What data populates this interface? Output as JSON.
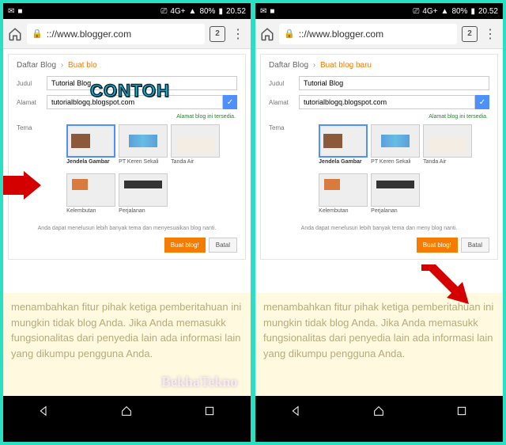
{
  "status": {
    "net": "4G+",
    "battery": "80%",
    "time": "20.52"
  },
  "chrome": {
    "url": ":://www.blogger.com",
    "tabs": "2"
  },
  "dialog": {
    "crumb_root": "Daftar Blog",
    "crumb_sep": "›",
    "crumb_cur_left": "Buat blo",
    "crumb_cur_full": "Buat blog baru",
    "lbl_title": "Judul",
    "val_title": "Tutorial Blog",
    "lbl_addr": "Alamat",
    "val_addr": "tutorialblogq.blogspot.com",
    "avail": "Alamat blog ini tersedia.",
    "lbl_theme": "Tema",
    "themes": [
      {
        "name": "Jendela Gambar",
        "cls": "th-jg",
        "selected": true
      },
      {
        "name": "PT Keren Sekali",
        "cls": "th-pt",
        "selected": false
      },
      {
        "name": "Tanda Air",
        "cls": "th-ta",
        "selected": false
      },
      {
        "name": "Kelembutan",
        "cls": "th-kl",
        "selected": false
      },
      {
        "name": "Perjalanan",
        "cls": "th-pj",
        "selected": false
      }
    ],
    "note_left": "Anda dapat menelusuri lebih banyak tema dan menyesuaikan blog nanti.",
    "note_right": "Anda dapat menelusuri lebih banyak tema dan meny         blog nanti.",
    "btn_create": "Buat blog!",
    "btn_cancel": "Batal"
  },
  "bg_text": "menambahkan fitur pihak ketiga pemberitahuan ini mungkin tidak blog Anda. Jika Anda memasukk fungsionalitas dari penyedia lain ada informasi lain yang dikumpu pengguna Anda.",
  "anno": {
    "contoh": "CONTOH",
    "watermark": "BekhaTekno"
  }
}
